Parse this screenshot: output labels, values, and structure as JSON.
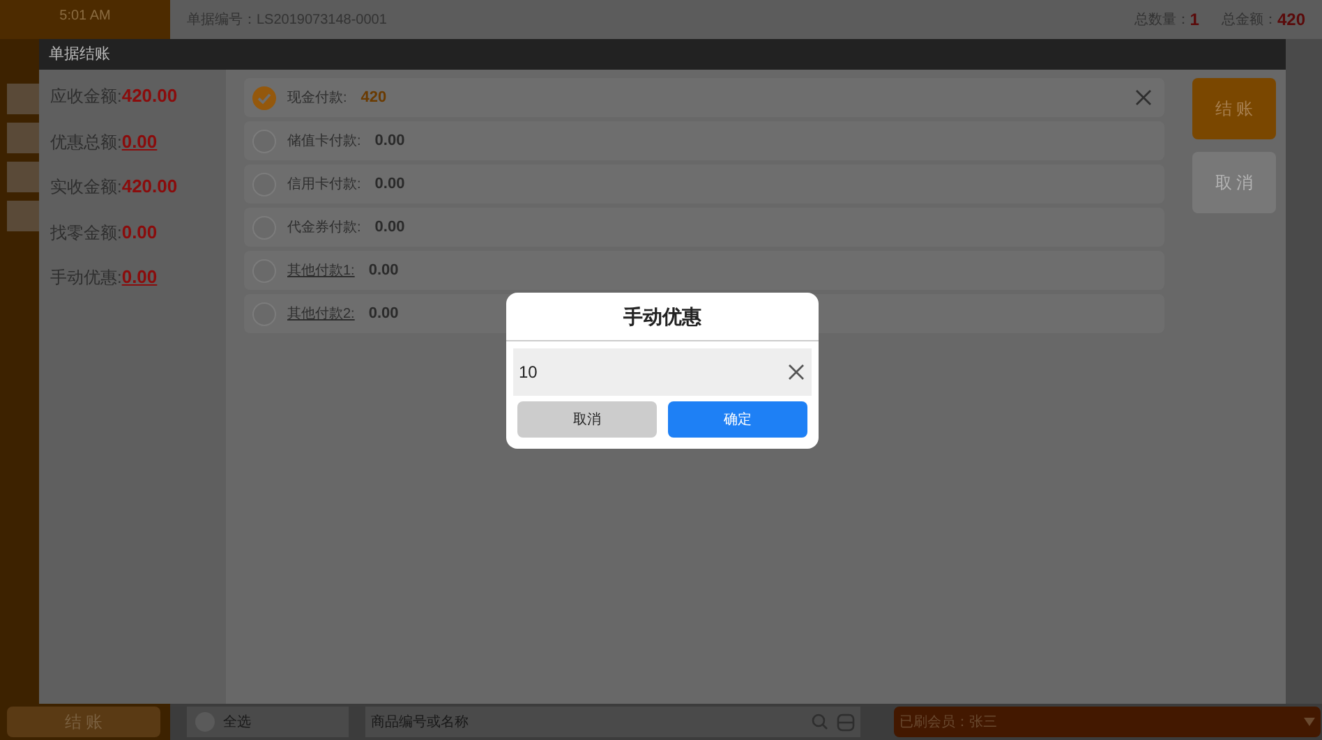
{
  "sidebar": {
    "time": "5:01 AM",
    "checkout_button": "结 账"
  },
  "top_bar": {
    "order_number_label": "单据编号：",
    "order_number": "LS2019073148-0001",
    "total_qty_label": "总数量：",
    "total_qty": "1",
    "total_amount_label": "总金额：",
    "total_amount": "420"
  },
  "bottom_bar": {
    "select_all": {
      "label": "全选",
      "checked": false
    },
    "search": {
      "placeholder": "商品编号或名称"
    },
    "member": "已刷会员：张三"
  },
  "checkout_dialog": {
    "title": "单据结账",
    "summary": [
      {
        "label": "应收金额:",
        "value": "420.00",
        "link": false
      },
      {
        "label": "优惠总额:",
        "value": "0.00",
        "link": true
      },
      {
        "label": "实收金额:",
        "value": "420.00",
        "link": false
      },
      {
        "label": "找零金额:",
        "value": "0.00",
        "link": false
      },
      {
        "label": "手动优惠:",
        "value": "0.00",
        "link": true
      }
    ],
    "payments": [
      {
        "label": "现金付款:",
        "value": "420",
        "selected": true,
        "link": false
      },
      {
        "label": "储值卡付款:",
        "value": "0.00",
        "selected": false,
        "link": false
      },
      {
        "label": "信用卡付款:",
        "value": "0.00",
        "selected": false,
        "link": false
      },
      {
        "label": "代金券付款:",
        "value": "0.00",
        "selected": false,
        "link": false
      },
      {
        "label": "其他付款1:",
        "value": "0.00",
        "selected": false,
        "link": true
      },
      {
        "label": "其他付款2:",
        "value": "0.00",
        "selected": false,
        "link": true
      }
    ],
    "buttons": [
      {
        "label": "结 账",
        "kind": "primary"
      },
      {
        "label": "取 消",
        "kind": "secondary"
      }
    ]
  },
  "discount_dialog": {
    "title": "手动优惠",
    "value": "10",
    "buttons": [
      {
        "label": "取消",
        "kind": "secondary"
      },
      {
        "label": "确定",
        "kind": "primary"
      }
    ]
  }
}
